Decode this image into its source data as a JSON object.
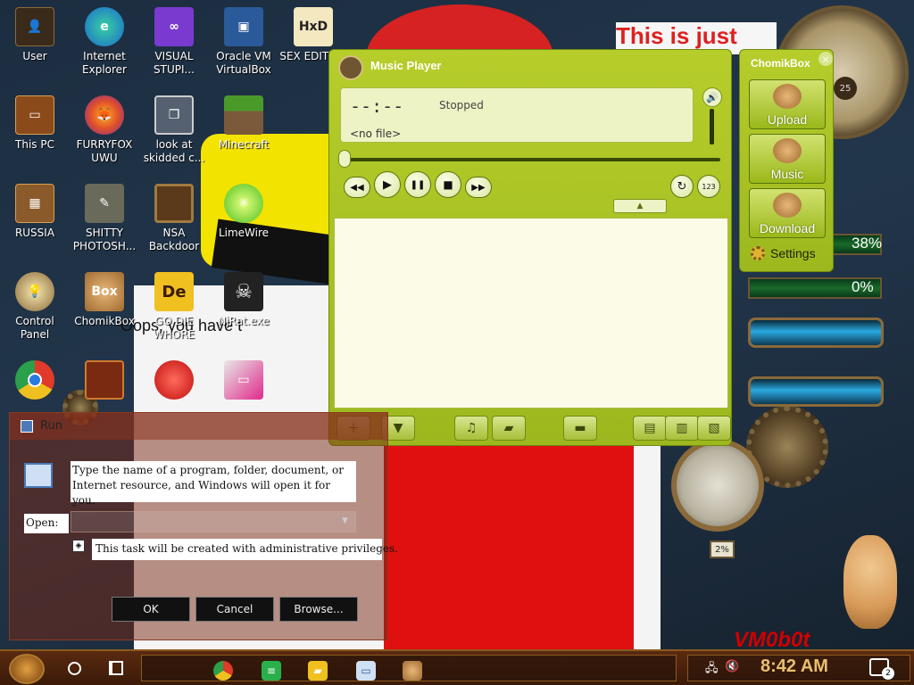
{
  "wallpaper": {
    "banner_text": "This is just",
    "oops_text": "Oops, you have t",
    "bottom_right_text": "VM0b0t",
    "clock_number": "25",
    "gauge1_value": "38%",
    "gauge2_value": "0%",
    "pressure_value": "2%"
  },
  "desktop_icons": [
    {
      "label": "User",
      "icon": "user-folder-icon"
    },
    {
      "label": "Internet Explorer",
      "icon": "edge-icon"
    },
    {
      "label": "VISUAL STUPI...",
      "icon": "visual-studio-icon"
    },
    {
      "label": "Oracle VM VirtualBox",
      "icon": "virtualbox-icon"
    },
    {
      "label": "SEX EDITO...",
      "icon": "hxd-icon"
    },
    {
      "label": "This PC",
      "icon": "computer-icon"
    },
    {
      "label": "FURRYFOX UWU",
      "icon": "firefox-icon"
    },
    {
      "label": "look at skidded c...",
      "icon": "stacked-windows-icon"
    },
    {
      "label": "Minecraft",
      "icon": "minecraft-icon"
    },
    {
      "label": "RUSSIA",
      "icon": "box-icon"
    },
    {
      "label": "SHITTY PHOTOSH...",
      "icon": "gimp-icon"
    },
    {
      "label": "NSA Backdoor",
      "icon": "frame-icon"
    },
    {
      "label": "LimeWire",
      "icon": "limewire-icon"
    },
    {
      "label": "Control Panel",
      "icon": "lightbulb-icon"
    },
    {
      "label": "ChomikBox",
      "icon": "chomikbox-icon"
    },
    {
      "label": "GO DIE WHORE",
      "icon": "de-icon"
    },
    {
      "label": "NjRat.exe",
      "icon": "skull-icon"
    }
  ],
  "music_player": {
    "title": "Music Player",
    "time": "--:--",
    "status": "Stopped",
    "file": "<no file>",
    "controls": {
      "rewind": "◀◀",
      "play": "▶",
      "pause": "❚❚",
      "stop": "■",
      "forward": "▶▶",
      "repeat": "↻",
      "shuffle": "123"
    },
    "expander": "▲",
    "volume_icon": "🔊"
  },
  "chomikbox": {
    "title": "ChomikBox",
    "close": "×",
    "upload_label": "Upload",
    "music_label": "Music",
    "download_label": "Download",
    "settings_label": "Settings"
  },
  "run_dialog": {
    "title": "Run",
    "description": "Type the name of a program, folder, document, or Internet resource, and Windows will open it for you.",
    "open_label": "Open:",
    "input_value": "",
    "admin_notice": "This task will be created with administrative privileges.",
    "ok_label": "OK",
    "cancel_label": "Cancel",
    "browse_label": "Browse..."
  },
  "taskbar": {
    "time": "8:42 AM",
    "notification_count": "2"
  },
  "colors": {
    "player_green": "#b6cd2a",
    "taskbar_brown": "#5a2a10",
    "clock_gold": "#e8c070"
  }
}
